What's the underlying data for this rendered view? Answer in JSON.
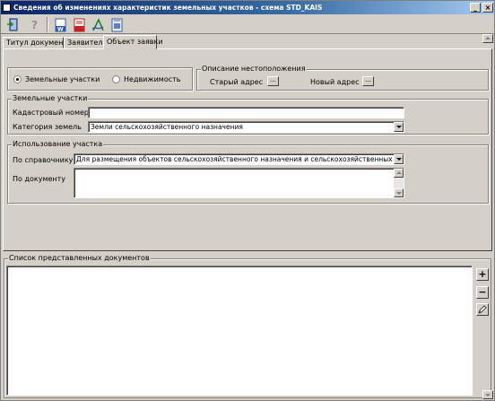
{
  "window": {
    "title": "Сведения об изменениях характеристик земельных участков - схема STD_KAIS",
    "minimize": "_",
    "close": "×"
  },
  "toolbar": {
    "icons": [
      "exit-icon",
      "help-icon",
      "word-icon",
      "pdf-icon",
      "sign-icon",
      "print-preview-icon"
    ]
  },
  "tabs": [
    {
      "label": "Титул документа"
    },
    {
      "label": "Заявитель"
    },
    {
      "label": "Объект заявки"
    }
  ],
  "object_type": {
    "options": [
      {
        "label": "Земельные участки",
        "selected": true
      },
      {
        "label": "Недвижимость",
        "selected": false
      }
    ]
  },
  "location": {
    "title": "Описание нестоположения",
    "old_address_label": "Старый адрес",
    "new_address_label": "Новый адрес",
    "button_label": "..."
  },
  "land": {
    "title": "Земельные участки",
    "cadastral_label": "Кадастровый номер",
    "cadastral_value": "",
    "category_label": "Категория земель",
    "category_value": "Земли сельскохозяйственного назначения"
  },
  "usage": {
    "title": "Использование участка",
    "ref_label": "По справочнику",
    "ref_value": "Для размещения объектов сельскохозяйственного назначения и сельскохозяйственных угодий",
    "doc_label": "По документу",
    "doc_value": ""
  },
  "documents": {
    "title": "Список представленных документов",
    "add": "+",
    "remove": "−"
  },
  "colors": {
    "face": "#d4d0c8",
    "title_start": "#0a246a",
    "title_end": "#a6caf0"
  }
}
